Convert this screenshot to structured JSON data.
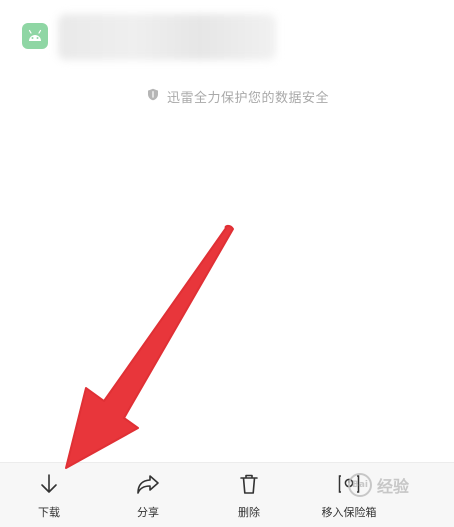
{
  "file": {
    "icon": "android-icon",
    "icon_color": "#8fd6a4",
    "name_blurred": true
  },
  "security_note": {
    "icon": "shield-icon",
    "text": "迅雷全力保护您的数据安全"
  },
  "actions": [
    {
      "label": "下载",
      "icon": "download-arrow-icon"
    },
    {
      "label": "分享",
      "icon": "share-arrow-icon"
    },
    {
      "label": "删除",
      "icon": "trash-icon"
    },
    {
      "label": "移入保险箱",
      "icon": "safe-box-icon"
    }
  ],
  "annotation": {
    "type": "red-arrow",
    "color": "#e8363b",
    "points_to": "download"
  },
  "watermark": {
    "text": "经验",
    "badge": "Bai"
  }
}
